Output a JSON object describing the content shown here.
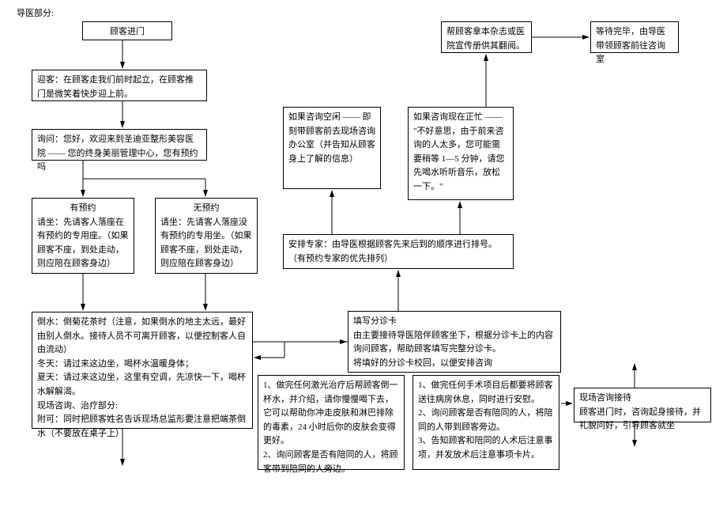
{
  "title": "导医部分:",
  "boxes": {
    "b1": "顾客进门",
    "b2": "迎客：在顾客走我们前时起立，在顾客推门是微笑着快步迎上前。",
    "b3": "询问：您好，欢迎来到圣迪亚整形美容医院 —— 您的终身美丽管理中心，您有预约吗",
    "b4_title": "有预约",
    "b4_body": "请坐：先请客人落座在有预约的专用座。（如果顾客不座，到处走动，则应陪在顾客身边）",
    "b5_title": "无预约",
    "b5_body": "请坐：先请客人落座没有预约的专用坐。（如果顾客不座，到处走动，则应陪在顾客身边）",
    "b6": "倒水：倒菊花茶时（注意，如果倒水的地主太远，最好由别人倒水。接待人员不可离开顾客，以便控制客人自由流动）\n冬天：请过来这边坐，喝杯水温暖身体；\n夏天：请过来这边坐，这里有空调，先凉快一下，喝杯水解解渴。\n现场咨询、治疗部分:\n附可：同时把顾客姓名告诉现场总监形要注意把端茶倒水（不要放在桌子上）",
    "b7": "如果咨询空闲 —— 即刻带顾客前去现场咨询办公室（并告知从顾客身上了解的信息）",
    "b8": "如果咨询现在正忙 —— \"不好意思，由于前来咨询的人太多，您可能需要稍等 1—5 分钟，请您先喝水听听音乐，放松一下。\"",
    "b9": "帮顾客拿本杂志或医院宣传册供其翻阅。",
    "b10": "等待完毕，由导医带领顾客前往咨询室",
    "b11": "安排专家：由导医根据顾客先来后到的顺序进行排号。（有预约专家的优先排列）",
    "b12": "填写分诊卡\n由主要接待导医陪伴顾客坐下，根据分诊卡上的内容询问顾客，帮助顾客填写完整分诊卡。\n将填好的分诊卡校回，以便安排咨询",
    "b13": "1、做完任何激光治疗后帮顾客倒一杯水，并介绍，请你慢慢喝下去，它可以帮助你冲走皮肤和淋巴排除的毒素，24 小时后你的皮肤会变得更好。\n2、询问顾客是否有陪同的人，将顾客带到陪同的人旁边。",
    "b14": "1、做完任何手术项目后都要将顾客送往病房休息，同时进行安慰。\n2、询问顾客是否有陪同的人，将陪同的人带到顾客旁边。\n3、告知顾客和陪同的人术后注意事项，并发放术后注意事项卡片。",
    "b15": "现场咨询接待\n顾客进门时，咨询起身接待，并礼貌问好，引导顾客就坐"
  }
}
